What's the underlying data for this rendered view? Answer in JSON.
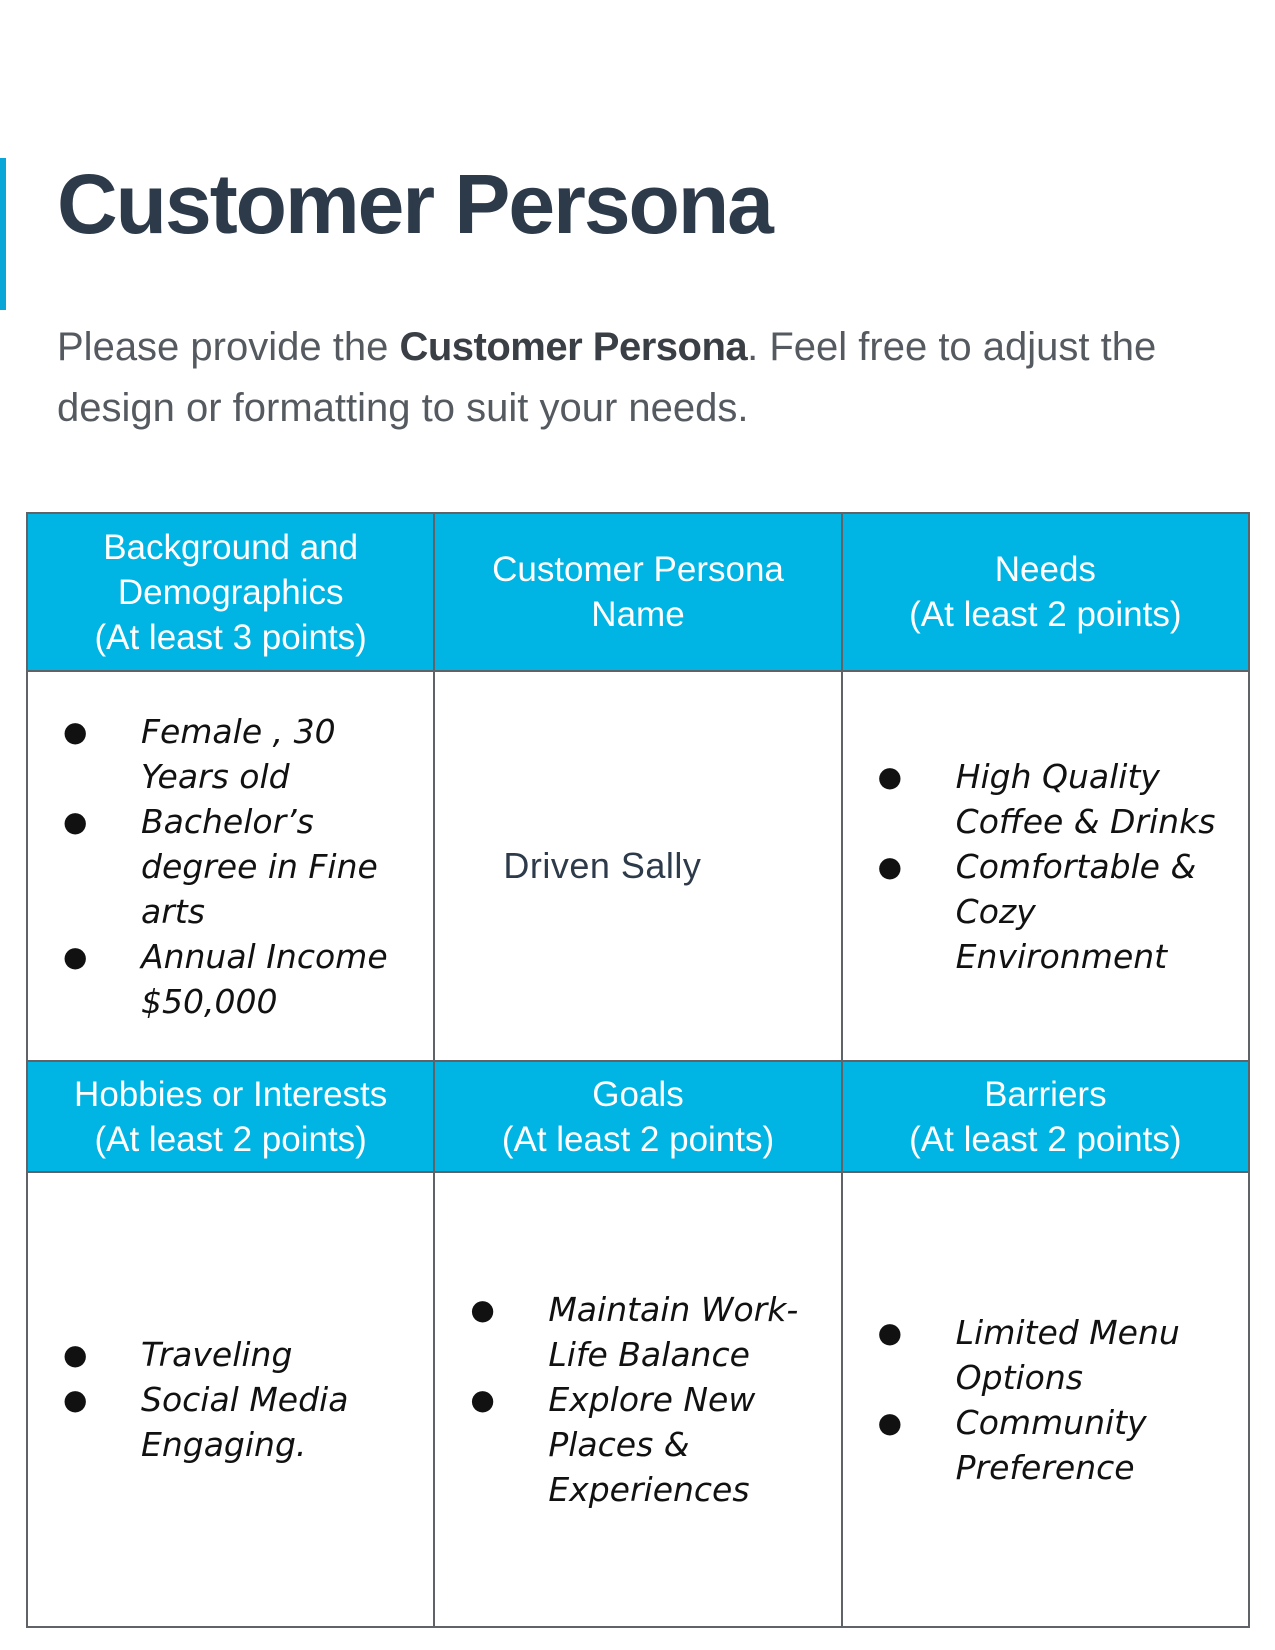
{
  "document": {
    "title": "Customer Persona",
    "intro": {
      "before": "Please provide the ",
      "bold": "Customer Persona",
      "after": ". Feel free to adjust the design or formatting to suit your needs."
    }
  },
  "table": {
    "row1_headers": [
      {
        "lines": [
          "Background  and",
          "Demographics",
          "(At least 3 points)"
        ]
      },
      {
        "lines": [
          "Customer  Persona",
          "Name"
        ]
      },
      {
        "lines": [
          "Needs",
          "(At least 2 points)"
        ]
      }
    ],
    "background_items": [
      "Female , 30 Years old",
      "Bachelor’s degree in Fine arts",
      "Annual Income $50,000"
    ],
    "persona_name": "Driven  Sally",
    "needs_items": [
      "High Quality Coffee & Drinks",
      "Comfortable & Cozy Environment"
    ],
    "row2_headers": [
      {
        "lines": [
          "Hobbies or  Interests",
          "(At least 2 points)"
        ]
      },
      {
        "lines": [
          "Goals",
          "(At least 2 points)"
        ]
      },
      {
        "lines": [
          "Barriers",
          "(At least 2 points)"
        ]
      }
    ],
    "hobbies_items": [
      "Traveling",
      "Social Media Engaging."
    ],
    "goals_items": [
      "Maintain Work-Life Balance",
      "Explore New Places & Experiences"
    ],
    "barriers_items": [
      "Limited Menu Options",
      "Community Preference"
    ],
    "bullet_symbol": "●",
    "header_color": "#00b4e4",
    "title_color": "#2d3a4a"
  }
}
